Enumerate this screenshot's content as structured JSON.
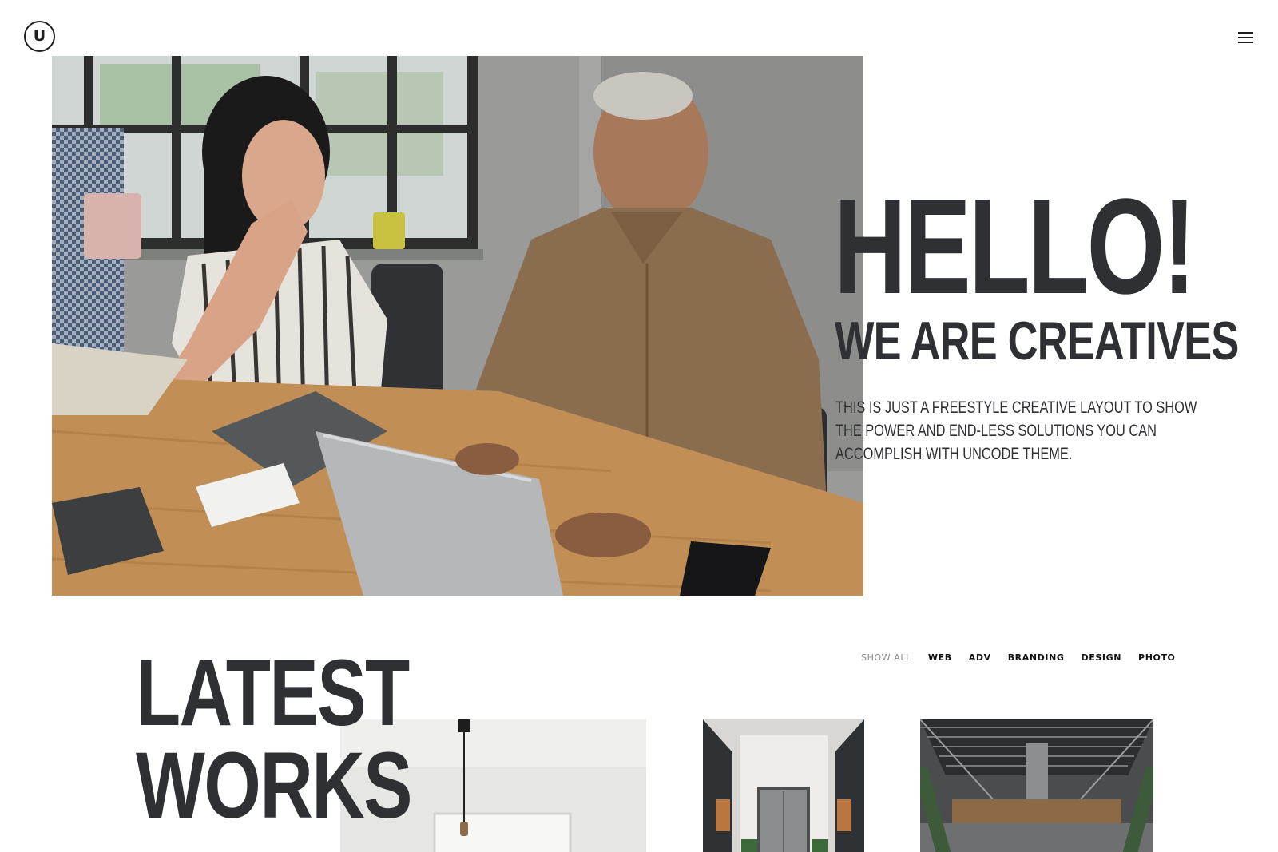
{
  "header": {
    "logo_letter": "U",
    "menu_icon": "hamburger-menu-icon"
  },
  "hero": {
    "title": "HELLO!",
    "subtitle": "WE ARE CREATIVES",
    "text": "THIS IS JUST A FREESTYLE CREATIVE LAYOUT TO SHOW THE POWER AND END-LESS SOLUTIONS YOU CAN ACCOMPLISH WITH UNCODE THEME.",
    "image_subject": "two people working at a wooden desk with a laptop"
  },
  "works": {
    "title_line1": "LATEST",
    "title_line2": "WORKS",
    "filters": [
      "SHOW ALL",
      "WEB",
      "ADV",
      "BRANDING",
      "DESIGN",
      "PHOTO"
    ],
    "active_filter": "SHOW ALL",
    "cards": [
      {
        "subject": "white room with pendant lamp"
      },
      {
        "subject": "hallway with elevator"
      },
      {
        "subject": "industrial steel structure interior"
      }
    ]
  },
  "colors": {
    "heading": "#2f3033",
    "filter_active": "#8b8b8b",
    "filter_default": "#111111",
    "background": "#ffffff"
  }
}
